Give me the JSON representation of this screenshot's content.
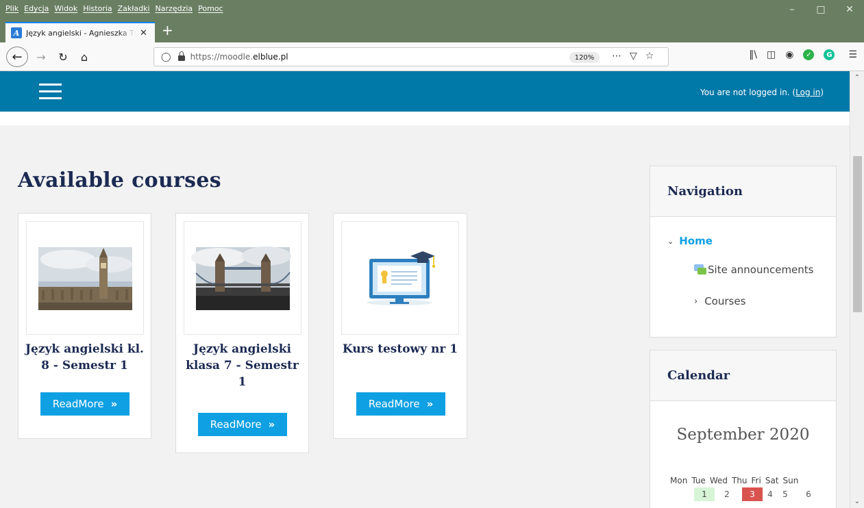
{
  "browser": {
    "menu": [
      "Plik",
      "Edycja",
      "Widok",
      "Historia",
      "Zakładki",
      "Narzędzia",
      "Pomoc"
    ],
    "tab_title": "Język angielski - Agnieszka The",
    "url_prefix": "https://moodle.",
    "url_domain": "elblue.pl",
    "zoom": "120%"
  },
  "header": {
    "login_prefix": "You are not logged in. (",
    "login_link": "Log in",
    "login_suffix": ")"
  },
  "main": {
    "heading": "Available courses",
    "read_more": "ReadMore",
    "courses": [
      {
        "title": "Język angielski kl. 8 - Semestr 1"
      },
      {
        "title": "Język angielski klasa 7 - Semestr 1"
      },
      {
        "title": "Kurs testowy nr 1"
      }
    ]
  },
  "navigation": {
    "title": "Navigation",
    "home": "Home",
    "site_announcements": "Site announcements",
    "courses": "Courses"
  },
  "calendar": {
    "title": "Calendar",
    "month": "September 2020",
    "weekdays": [
      "Mon",
      "Tue",
      "Wed",
      "Thu",
      "Fri",
      "Sat",
      "Sun"
    ],
    "days": [
      "1",
      "2",
      "3",
      "4",
      "5",
      "6"
    ]
  },
  "colors": {
    "header_blue": "#0078a8",
    "button_blue": "#0fa0e3",
    "heading_navy": "#1b2a52",
    "today_red": "#d9534f",
    "event_green": "#d7f4d7"
  }
}
